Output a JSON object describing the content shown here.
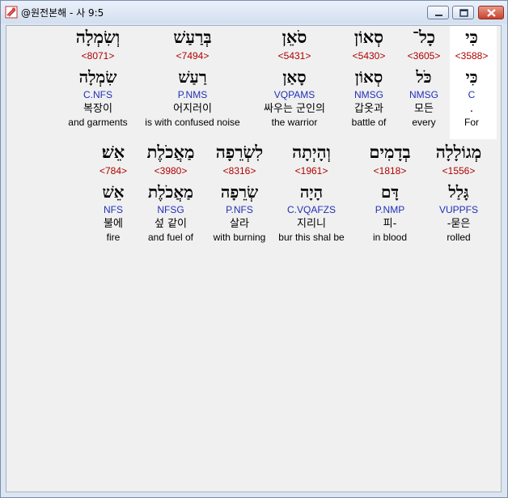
{
  "window": {
    "title": "@원전본해 - 사 9:5",
    "controls": {
      "minimize": "minimize-icon",
      "maximize": "maximize-icon",
      "close": "close-icon"
    }
  },
  "rows": [
    {
      "words": [
        {
          "hebrew": "כִּי",
          "strong": "<3588>",
          "lemma": "כִּי",
          "morph": "C",
          "korean": ".",
          "english": "For"
        },
        {
          "hebrew": "כָל־",
          "strong": "<3605>",
          "lemma": "כֹּל",
          "morph": "NMSG",
          "korean": "모든",
          "english": "every"
        },
        {
          "hebrew": "סְאוֹן",
          "strong": "<5430>",
          "lemma": "סְאוֹן",
          "morph": "NMSG",
          "korean": "갑옷과",
          "english": "battle of"
        },
        {
          "hebrew": "סֹאֵן",
          "strong": "<5431>",
          "lemma": "סָאַן",
          "morph": "VQPAMS",
          "korean": "싸우는 군인의",
          "english": "the warrior"
        },
        {
          "hebrew": "בְּרַעַשׁ",
          "strong": "<7494>",
          "lemma": "רַעַשׁ",
          "morph": "P.NMS",
          "korean": "어지러이",
          "english": "is with confused noise"
        },
        {
          "hebrew": "וְשִׂמְלָה",
          "strong": "<8071>",
          "lemma": "שִׂמְלָה",
          "morph": "C.NFS",
          "korean": "복장이",
          "english": "and garments"
        }
      ]
    },
    {
      "words": [
        {
          "hebrew": "מְגוֹלָלָה",
          "strong": "<1556>",
          "lemma": "גָּלַל",
          "morph": "VUPPFS",
          "korean": "-묻은",
          "english": "rolled"
        },
        {
          "hebrew": "בְדָמִים",
          "strong": "<1818>",
          "lemma": "דָּם",
          "morph": "P.NMP",
          "korean": "피-",
          "english": "in blood"
        },
        {
          "hebrew": "וְהָיְתָה",
          "strong": "<1961>",
          "lemma": "הָיָה",
          "morph": "C.VQAFZS",
          "korean": "지리니",
          "english": "bur this shal be"
        },
        {
          "hebrew": "לִשְׂרֵפָה",
          "strong": "<8316>",
          "lemma": "שְׂרֵפָה",
          "morph": "P.NFS",
          "korean": "살라",
          "english": "with burning"
        },
        {
          "hebrew": "מַאֲכֹלֶת",
          "strong": "<3980>",
          "lemma": "מַאֲכֹלֶת",
          "morph": "NFSG",
          "korean": "섶 같이",
          "english": "and fuel of"
        },
        {
          "hebrew": "אֵשׁ׃",
          "strong": "<784>",
          "lemma": "אֵשׁ",
          "morph": "NFS",
          "korean": "불에",
          "english": "fire"
        }
      ]
    }
  ]
}
